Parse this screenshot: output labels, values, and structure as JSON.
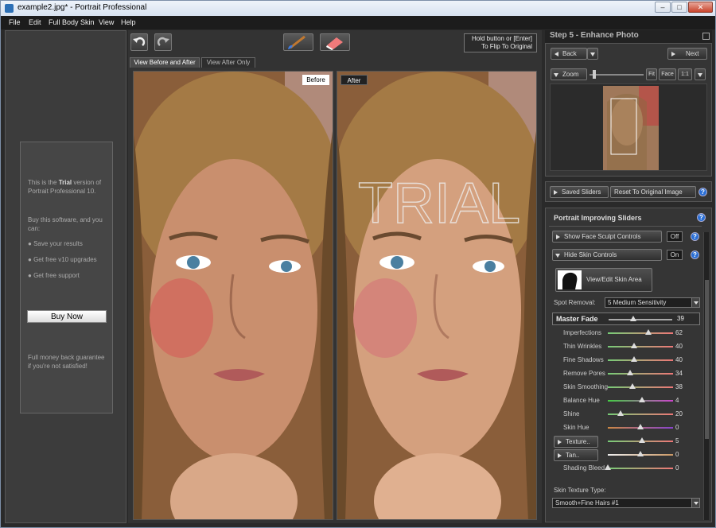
{
  "window": {
    "title": "example2.jpg* - Portrait Professional",
    "min": "–",
    "max": "□",
    "close": "✕"
  },
  "menu": [
    "File",
    "Edit",
    "Full Body Skin",
    "View",
    "Help"
  ],
  "trial_panel": {
    "line1a": "This is the ",
    "line1b": "Trial",
    "line1c": " version of Portrait Professional 10.",
    "buy_intro": "Buy this software, and you can:",
    "benefits": [
      "Save your results",
      "Get free v10 upgrades",
      "Get free support"
    ],
    "buy_button": "Buy Now",
    "guarantee": "Full money back guarantee if you're not satisfied!"
  },
  "toolbar": {
    "flip_note_line1": "Hold button or [Enter]",
    "flip_note_line2": "To Flip To Original"
  },
  "view_tabs": {
    "before_after": "View Before and After",
    "after_only": "View After Only"
  },
  "photos": {
    "before_label": "Before",
    "after_label": "After",
    "watermark": "TRIAL"
  },
  "step": {
    "title": "Step 5 - Enhance Photo",
    "back": "Back",
    "next": "Next"
  },
  "zoom": {
    "label": "Zoom",
    "fit": "Fit",
    "face": "Face",
    "one_to_one": "1:1"
  },
  "saved": {
    "saved_sliders": "Saved Sliders",
    "reset": "Reset To Original Image"
  },
  "sliders_panel": {
    "title": "Portrait Improving Sliders",
    "face_sculpt": "Show Face Sculpt Controls",
    "face_sculpt_state": "Off",
    "skin_controls": "Hide Skin Controls",
    "skin_controls_state": "On",
    "skin_area": "View/Edit Skin Area",
    "spot_removal_label": "Spot Removal:",
    "spot_removal_value": "5 Medium Sensitivity",
    "master_fade_label": "Master Fade",
    "master_fade_value": "39",
    "skin_texture_type_label": "Skin Texture Type:",
    "skin_texture_type_value": "Smooth+Fine Hairs #1"
  },
  "sliders": [
    {
      "label": "Imperfections",
      "value": "62",
      "pos": 0.62,
      "button": false
    },
    {
      "label": "Thin Wrinkles",
      "value": "40",
      "pos": 0.4,
      "button": false
    },
    {
      "label": "Fine Shadows",
      "value": "40",
      "pos": 0.4,
      "button": false
    },
    {
      "label": "Remove Pores",
      "value": "34",
      "pos": 0.34,
      "button": false
    },
    {
      "label": "Skin Smoothing",
      "value": "38",
      "pos": 0.38,
      "button": false
    },
    {
      "label": "Balance Hue",
      "value": "4",
      "pos": 0.52,
      "button": false
    },
    {
      "label": "Shine",
      "value": "20",
      "pos": 0.2,
      "button": false
    },
    {
      "label": "Skin Hue",
      "value": "0",
      "pos": 0.5,
      "button": false
    },
    {
      "label": "Texture..",
      "value": "5",
      "pos": 0.53,
      "button": true
    },
    {
      "label": "Tan..",
      "value": "0",
      "pos": 0.5,
      "button": true
    },
    {
      "label": "Shading Bleed",
      "value": "0",
      "pos": 0.0,
      "button": false
    }
  ],
  "colors": {
    "accent_help": "#2a6fd6",
    "panel": "#353535",
    "background": "#2a2a2a"
  }
}
